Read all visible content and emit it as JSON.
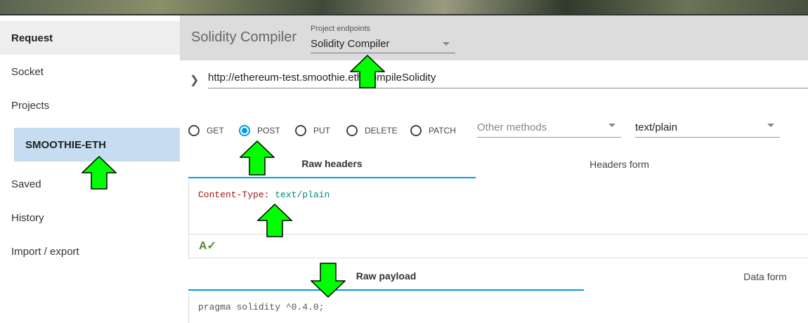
{
  "sidebar": {
    "items": [
      {
        "label": "Request"
      },
      {
        "label": "Socket"
      },
      {
        "label": "Projects"
      },
      {
        "label": "SMOOTHIE-ETH"
      },
      {
        "label": "Saved"
      },
      {
        "label": "History"
      },
      {
        "label": "Import / export"
      }
    ]
  },
  "header": {
    "title": "Solidity Compiler",
    "endpoints_label": "Project endpoints",
    "endpoints_value": "Solidity Compiler"
  },
  "url": {
    "value": "http://ethereum-test.smoothie.eth/compileSolidity"
  },
  "methods": {
    "options": [
      {
        "label": "GET",
        "checked": false
      },
      {
        "label": "POST",
        "checked": true
      },
      {
        "label": "PUT",
        "checked": false
      },
      {
        "label": "DELETE",
        "checked": false
      },
      {
        "label": "PATCH",
        "checked": false
      }
    ],
    "other_placeholder": "Other methods",
    "content_type": "text/plain"
  },
  "headers_tabs": [
    {
      "label": "Raw headers",
      "active": true
    },
    {
      "label": "Headers form",
      "active": false
    }
  ],
  "headers_editor": {
    "key": "Content-Type:",
    "value": "text/plain"
  },
  "payload_tabs": [
    {
      "label": "Raw payload",
      "active": true
    },
    {
      "label": "Data form",
      "active": false
    }
  ],
  "payload_editor": {
    "text": "pragma solidity ^0.4.0;"
  },
  "colors": {
    "accent": "#039be5",
    "arrow": "#00ff00",
    "selected_item": "#c5dcf1"
  },
  "icons": {
    "url_toggle": "chevron-right-icon",
    "dropdown": "caret-down-icon",
    "spellcheck": "spellcheck-icon",
    "annotation": "green-arrow-icon"
  }
}
